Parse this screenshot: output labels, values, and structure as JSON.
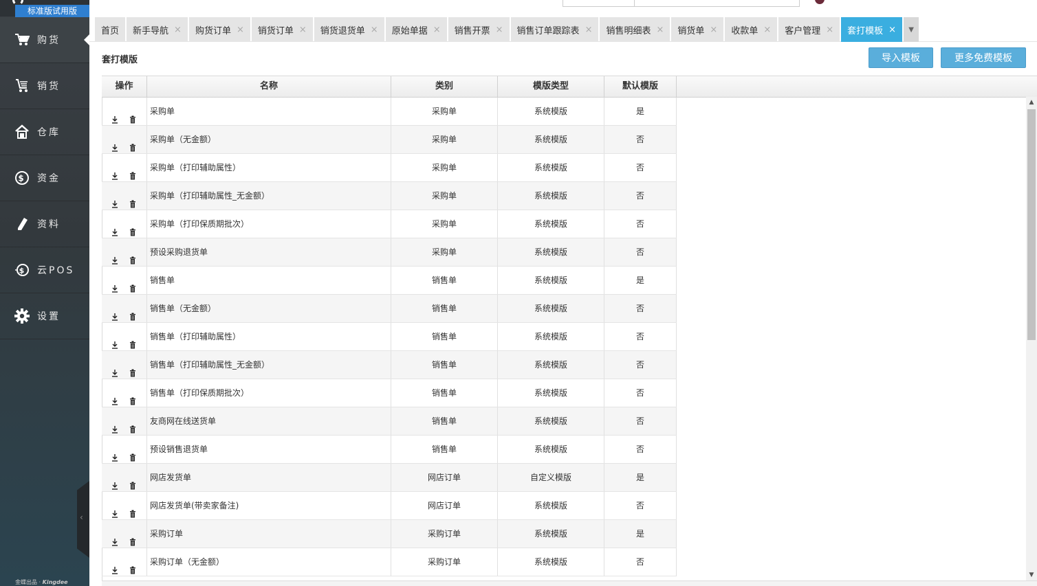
{
  "sidebar": {
    "trial_badge": "标准版试用版",
    "items": [
      {
        "label": "购货",
        "icon": "cart-icon"
      },
      {
        "label": "销货",
        "icon": "sales-cart-icon"
      },
      {
        "label": "仓库",
        "icon": "warehouse-icon"
      },
      {
        "label": "资金",
        "icon": "dollar-icon"
      },
      {
        "label": "资料",
        "icon": "pencil-icon"
      },
      {
        "label": "云POS",
        "icon": "pos-dollar-icon"
      },
      {
        "label": "设置",
        "icon": "gear-icon"
      }
    ],
    "collapse_label": "‹",
    "brand_prefix": "金蝶出品 · ",
    "brand_name": "Kingdee"
  },
  "tabs": [
    {
      "label": "首页",
      "closable": false
    },
    {
      "label": "新手导航",
      "closable": true
    },
    {
      "label": "购货订单",
      "closable": true
    },
    {
      "label": "销货订单",
      "closable": true
    },
    {
      "label": "销货退货单",
      "closable": true
    },
    {
      "label": "原始单据",
      "closable": true
    },
    {
      "label": "销售开票",
      "closable": true
    },
    {
      "label": "销售订单跟踪表",
      "closable": true
    },
    {
      "label": "销售明细表",
      "closable": true
    },
    {
      "label": "销货单",
      "closable": true
    },
    {
      "label": "收款单",
      "closable": true
    },
    {
      "label": "客户管理",
      "closable": true
    },
    {
      "label": "套打模板",
      "closable": true,
      "active": true
    }
  ],
  "tab_close_glyph": "×",
  "tab_more_glyph": "▼",
  "page": {
    "title": "套打模版",
    "import_button": "导入模板",
    "more_button": "更多免费模板"
  },
  "table": {
    "headers": [
      "操作",
      "名称",
      "类别",
      "模版类型",
      "默认模版"
    ],
    "rows": [
      {
        "name": "采购单",
        "category": "采购单",
        "type": "系统模版",
        "default": "是"
      },
      {
        "name": "采购单（无金额）",
        "category": "采购单",
        "type": "系统模版",
        "default": "否"
      },
      {
        "name": "采购单（打印辅助属性）",
        "category": "采购单",
        "type": "系统模版",
        "default": "否"
      },
      {
        "name": "采购单（打印辅助属性_无金额）",
        "category": "采购单",
        "type": "系统模版",
        "default": "否"
      },
      {
        "name": "采购单（打印保质期批次）",
        "category": "采购单",
        "type": "系统模版",
        "default": "否"
      },
      {
        "name": "预设采购退货单",
        "category": "采购单",
        "type": "系统模版",
        "default": "否"
      },
      {
        "name": "销售单",
        "category": "销售单",
        "type": "系统模版",
        "default": "是"
      },
      {
        "name": "销售单（无金额）",
        "category": "销售单",
        "type": "系统模版",
        "default": "否"
      },
      {
        "name": "销售单（打印辅助属性）",
        "category": "销售单",
        "type": "系统模版",
        "default": "否"
      },
      {
        "name": "销售单（打印辅助属性_无金额）",
        "category": "销售单",
        "type": "系统模版",
        "default": "否"
      },
      {
        "name": "销售单（打印保质期批次）",
        "category": "销售单",
        "type": "系统模版",
        "default": "否"
      },
      {
        "name": "友商网在线送货单",
        "category": "销售单",
        "type": "系统模版",
        "default": "否"
      },
      {
        "name": "预设销售退货单",
        "category": "销售单",
        "type": "系统模版",
        "default": "否"
      },
      {
        "name": "网店发货单",
        "category": "网店订单",
        "type": "自定义模版",
        "default": "是"
      },
      {
        "name": "网店发货单(带卖家备注)",
        "category": "网店订单",
        "type": "系统模版",
        "default": "否"
      },
      {
        "name": "采购订单",
        "category": "采购订单",
        "type": "系统模版",
        "default": "是"
      },
      {
        "name": "采购订单（无金额）",
        "category": "采购订单",
        "type": "系统模版",
        "default": "否"
      }
    ]
  },
  "colors": {
    "sidebar_bg": "#33393d",
    "trial_badge": "#2f7fd0",
    "active_tab": "#3aaee0",
    "tab_bg": "#e5e5e5",
    "button": "#5aaedb",
    "row_alt": "#f5f5f5"
  }
}
